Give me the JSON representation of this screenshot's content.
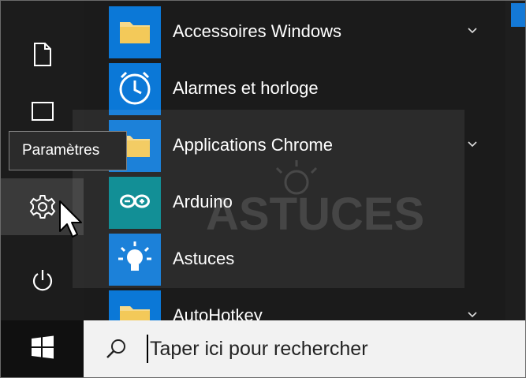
{
  "colors": {
    "accent": "#0b78d7",
    "rail_bg": "#1c1c1c",
    "list_bg": "#1b1b1b",
    "taskbar_bg": "#101010",
    "search_bg": "#f2f2f2"
  },
  "rail": {
    "items": [
      {
        "name": "documents",
        "icon": "document-icon"
      },
      {
        "name": "pictures",
        "icon": "pictures-icon"
      },
      {
        "name": "settings",
        "icon": "gear-icon"
      },
      {
        "name": "power",
        "icon": "power-icon"
      }
    ]
  },
  "tooltip": {
    "text": "Paramètres"
  },
  "apps": [
    {
      "label": "Accessoires Windows",
      "icon": "folder-icon",
      "expandable": true
    },
    {
      "label": "Alarmes et horloge",
      "icon": "alarm-clock-icon",
      "expandable": false
    },
    {
      "label": "Applications Chrome",
      "icon": "folder-icon",
      "expandable": true
    },
    {
      "label": "Arduino",
      "icon": "arduino-icon",
      "expandable": false
    },
    {
      "label": "Astuces",
      "icon": "lightbulb-icon",
      "expandable": false
    },
    {
      "label": "AutoHotkey",
      "icon": "folder-icon",
      "expandable": true
    }
  ],
  "watermark": {
    "text": "ASTUCES"
  },
  "taskbar": {
    "start_icon": "windows-logo-icon",
    "search_placeholder": "Taper ici pour rechercher",
    "search_icon": "search-icon"
  }
}
